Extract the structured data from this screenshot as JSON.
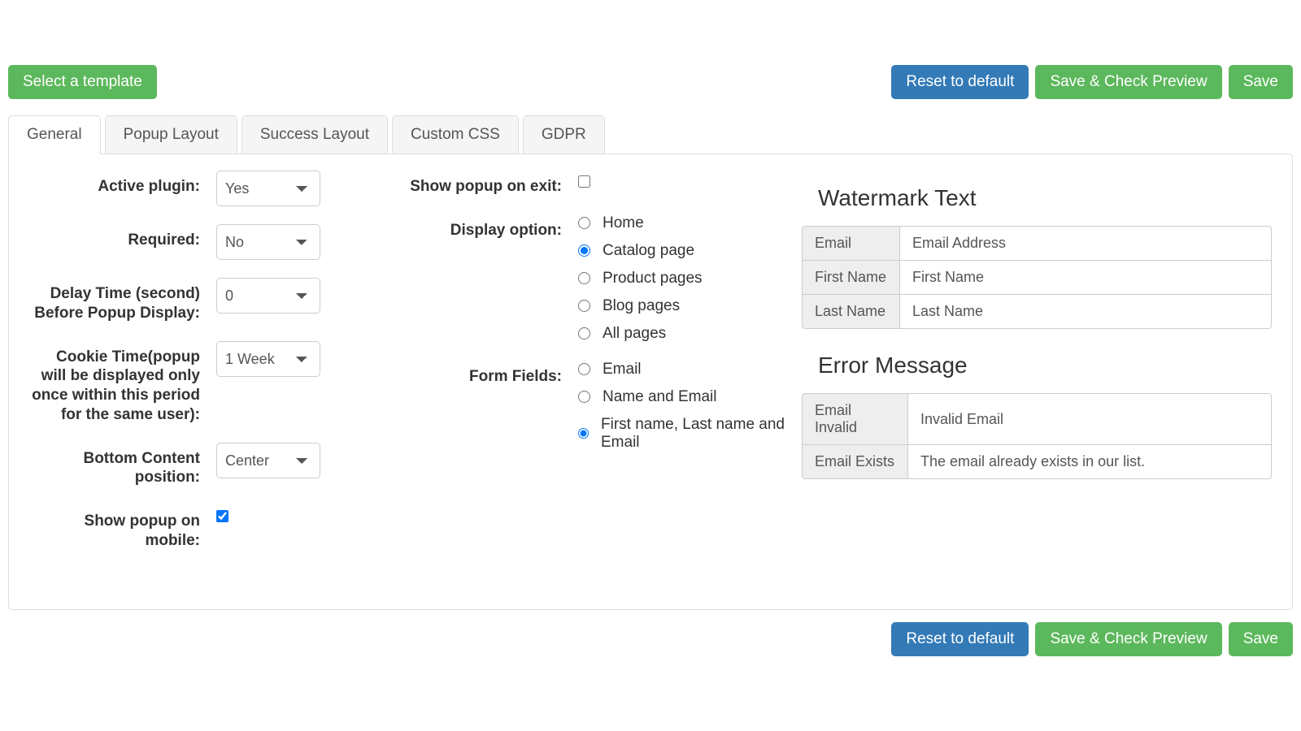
{
  "toolbar": {
    "select_template": "Select a template",
    "reset": "Reset to default",
    "save_preview": "Save & Check Preview",
    "save": "Save"
  },
  "tabs": [
    "General",
    "Popup Layout",
    "Success Layout",
    "Custom CSS",
    "GDPR"
  ],
  "left": {
    "active_plugin": {
      "label": "Active plugin:",
      "value": "Yes"
    },
    "required": {
      "label": "Required:",
      "value": "No"
    },
    "delay": {
      "label": "Delay Time (second) Before Popup Display:",
      "value": "0"
    },
    "cookie": {
      "label": "Cookie Time(popup will be displayed only once within this period for the same user):",
      "value": "1 Week"
    },
    "bottom_pos": {
      "label": "Bottom Content position:",
      "value": "Center"
    },
    "show_mobile": {
      "label": "Show popup on mobile:",
      "checked": true
    }
  },
  "mid": {
    "show_exit": {
      "label": "Show popup on exit:",
      "checked": false
    },
    "display_option": {
      "label": "Display option:",
      "options": [
        "Home",
        "Catalog page",
        "Product pages",
        "Blog pages",
        "All pages"
      ],
      "selected": 1
    },
    "form_fields": {
      "label": "Form Fields:",
      "options": [
        "Email",
        "Name and Email",
        "First name, Last name and Email"
      ],
      "selected": 2
    }
  },
  "right": {
    "watermark_title": "Watermark Text",
    "watermark": [
      {
        "label": "Email",
        "value": "Email Address"
      },
      {
        "label": "First Name",
        "value": "First Name"
      },
      {
        "label": "Last Name",
        "value": "Last Name"
      }
    ],
    "error_title": "Error Message",
    "errors": [
      {
        "label": "Email Invalid",
        "value": "Invalid Email"
      },
      {
        "label": "Email Exists",
        "value": "The email already exists in our list."
      }
    ]
  }
}
